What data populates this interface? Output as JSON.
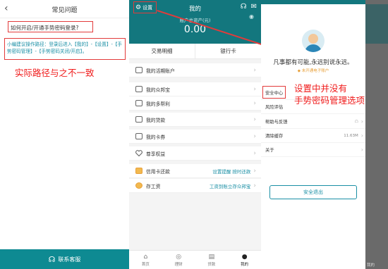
{
  "faq": {
    "back_icon": "‹",
    "title": "常见问题",
    "question": "如何开启/开通手势密码登录?",
    "answer": "小编建议操作路径：登录后进入【我的】-【设置】-【手势密码管理】-【手势密码关闭/开启】。",
    "annotation": "实际路径与之不一致",
    "customer_service": "联系客服",
    "customer_service_icon": "☊"
  },
  "mine": {
    "settings_label": "设置",
    "settings_icon": "⚙",
    "title": "我的",
    "header_icons": [
      "☊",
      "✉"
    ],
    "eye_icon": "◉",
    "asset_label": "账户总资产(元)",
    "asset_value": "0.00",
    "tabs": [
      "交易明细",
      "银行卡"
    ],
    "rows": [
      {
        "label": "我的活期账户",
        "extra": ""
      },
      {
        "label": "我的众邦宝",
        "extra": ""
      },
      {
        "label": "我的多帮利",
        "extra": ""
      },
      {
        "label": "我的贷款",
        "extra": ""
      },
      {
        "label": "我的卡券",
        "extra": ""
      },
      {
        "label": "尊享权益",
        "extra": ""
      },
      {
        "label": "信用卡还款",
        "extra": "设置提醒 按时还款"
      },
      {
        "label": "存工资",
        "extra": "工资到账立存众邦宝"
      }
    ],
    "chevron": "›",
    "nav": [
      {
        "label": "首页",
        "icon": "⌂"
      },
      {
        "label": "理财",
        "icon": "◎"
      },
      {
        "label": "贷款",
        "icon": "▤"
      },
      {
        "label": "我的",
        "icon": "●"
      }
    ]
  },
  "drawer": {
    "motto": "凡事都有可能,永远别说永远。",
    "sub": "◆ 未开通电子账户",
    "items": [
      {
        "label": "安全中心",
        "right": ""
      },
      {
        "label": "风险评估",
        "right": ""
      },
      {
        "label": "帮助与反馈",
        "right": "☖"
      },
      {
        "label": "清除缓存",
        "right": "11.63M"
      },
      {
        "label": "关于",
        "right": ""
      }
    ],
    "annotation_line1": "设置中并没有",
    "annotation_line2": "手势密码管理选项",
    "logout": "安全退出",
    "bg_label": "我的"
  },
  "colors": {
    "teal": "#13777e",
    "annotation_red": "#f01c1c",
    "link_teal": "#1a8fa5",
    "accent_orange": "#e8a03a"
  }
}
